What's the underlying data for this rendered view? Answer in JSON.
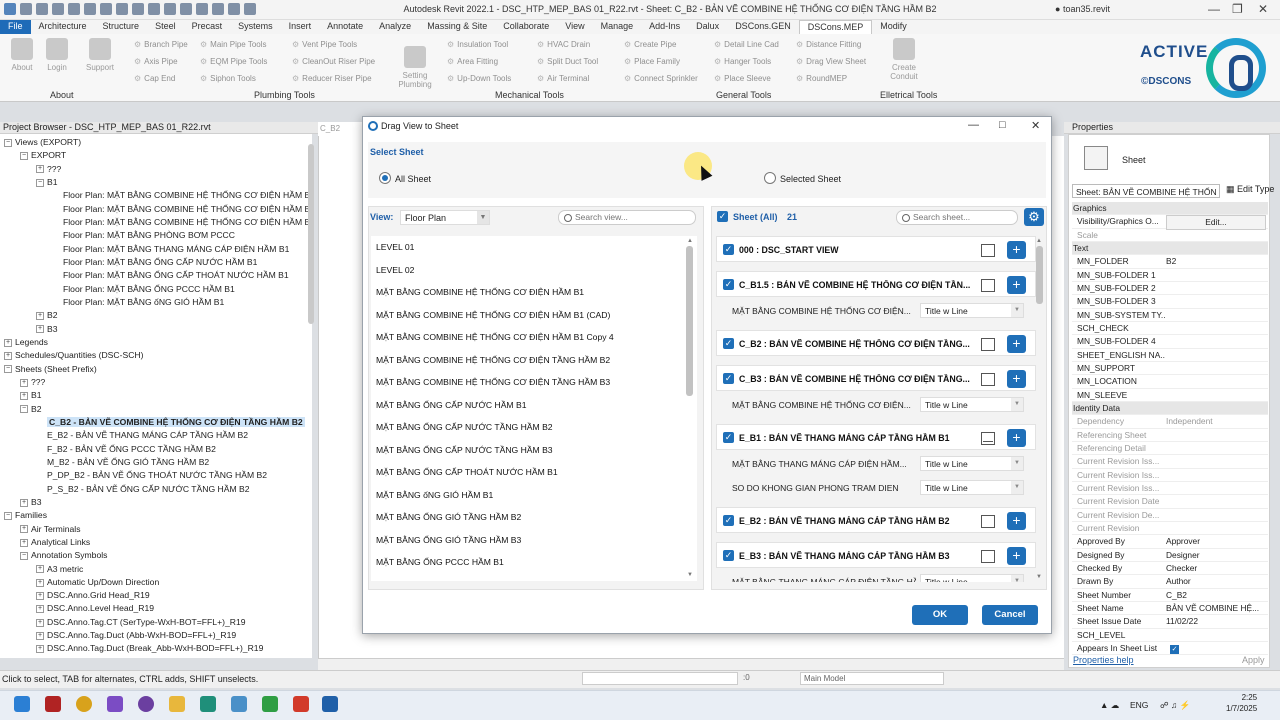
{
  "window": {
    "title": "Autodesk Revit 2022.1 - DSC_HTP_MEP_BAS 01_R22.rvt - Sheet: C_B2 - BẢN VẼ COMBINE HỆ THỐNG CƠ ĐIỆN TẦNG HẦM B2",
    "user": "toan35.revit"
  },
  "menu": [
    "File",
    "Architecture",
    "Structure",
    "Steel",
    "Precast",
    "Systems",
    "Insert",
    "Annotate",
    "Analyze",
    "Massing & Site",
    "Collaborate",
    "View",
    "Manage",
    "Add-Ins",
    "Dalux",
    "DSCons.GEN",
    "DSCons.MEP",
    "Modify"
  ],
  "ribbon": {
    "about": {
      "buttons": [
        "About",
        "Login",
        "Support"
      ],
      "label": "About"
    },
    "plumbing": {
      "col1": [
        "Branch Pipe",
        "Axis Pipe",
        "Cap End"
      ],
      "col2": [
        "Main Pipe Tools",
        "EQM Pipe Tools",
        "Siphon Tools"
      ],
      "col3": [
        "Vent Pipe Tools",
        "CleanOut Riser Pipe",
        "Reducer Riser Pipe"
      ],
      "big": "Setting Plumbing",
      "label": "Plumbing Tools"
    },
    "mechanical": {
      "col1": [
        "Insulation Tool",
        "Area Fitting",
        "Up-Down Tools"
      ],
      "col2": [
        "HVAC Drain",
        "Split Duct Tool",
        "Air Terminal"
      ],
      "label": "Mechanical Tools"
    },
    "general": {
      "col1": [
        "Create Pipe",
        "Place Family",
        "Connect Sprinkler"
      ],
      "col2": [
        "Detail Line Cad",
        "Hanger Tools",
        "Place Sleeve"
      ],
      "col3": [
        "Distance Fitting",
        "Drag View Sheet",
        "RoundMEP"
      ],
      "label": "General Tools"
    },
    "electrical": {
      "big": "Create Conduit",
      "label": "Elletrical Tools"
    }
  },
  "brand": {
    "active": "ACTIVE",
    "sub": "©DSCONS"
  },
  "project_browser": {
    "title": "Project Browser - DSC_HTP_MEP_BAS 01_R22.rvt",
    "rows": [
      {
        "i": 0,
        "e": "-",
        "t": "Views (EXPORT)"
      },
      {
        "i": 1,
        "e": "-",
        "t": "EXPORT"
      },
      {
        "i": 2,
        "e": "+",
        "t": "???"
      },
      {
        "i": 2,
        "e": "-",
        "t": "B1"
      },
      {
        "i": 3,
        "e": "",
        "t": "Floor Plan: MẶT BẰNG COMBINE HỆ THỐNG CƠ ĐIỆN HẦM B"
      },
      {
        "i": 3,
        "e": "",
        "t": "Floor Plan: MẶT BẰNG COMBINE HỆ THỐNG CƠ ĐIỆN HẦM B"
      },
      {
        "i": 3,
        "e": "",
        "t": "Floor Plan: MẶT BẰNG COMBINE HỆ THỐNG CƠ ĐIỆN HẦM B"
      },
      {
        "i": 3,
        "e": "",
        "t": "Floor Plan: MẶT BẰNG PHÒNG BƠM PCCC"
      },
      {
        "i": 3,
        "e": "",
        "t": "Floor Plan: MẶT BẰNG THANG MÁNG CÁP ĐIỆN HẦM B1"
      },
      {
        "i": 3,
        "e": "",
        "t": "Floor Plan: MẶT BẰNG ỐNG CẤP NƯỚC HẦM B1"
      },
      {
        "i": 3,
        "e": "",
        "t": "Floor Plan: MẶT BẰNG ỐNG CẤP THOÁT NƯỚC HẦM B1"
      },
      {
        "i": 3,
        "e": "",
        "t": "Floor Plan: MẶT BẰNG ỐNG PCCC HẦM B1"
      },
      {
        "i": 3,
        "e": "",
        "t": "Floor Plan: MẶT BẰNG ốNG GIÓ HẦM B1"
      },
      {
        "i": 2,
        "e": "+",
        "t": "B2"
      },
      {
        "i": 2,
        "e": "+",
        "t": "B3"
      },
      {
        "i": 0,
        "e": "+",
        "t": "Legends"
      },
      {
        "i": 0,
        "e": "+",
        "t": "Schedules/Quantities (DSC-SCH)"
      },
      {
        "i": 0,
        "e": "-",
        "t": "Sheets (Sheet Prefix)"
      },
      {
        "i": 1,
        "e": "+",
        "t": "???"
      },
      {
        "i": 1,
        "e": "+",
        "t": "B1"
      },
      {
        "i": 1,
        "e": "-",
        "t": "B2"
      },
      {
        "i": 2,
        "e": "",
        "t": "C_B2 - BẢN VẼ COMBINE HỆ THỐNG CƠ ĐIỆN TẦNG HẦM B2",
        "sel": true
      },
      {
        "i": 2,
        "e": "",
        "t": "E_B2 - BẢN VẼ THANG MÁNG CÁP TẦNG HẦM B2"
      },
      {
        "i": 2,
        "e": "",
        "t": "F_B2 - BẢN VẼ ỐNG PCCC TẦNG HẦM B2"
      },
      {
        "i": 2,
        "e": "",
        "t": "M_B2 - BẢN VẼ ỐNG GIÓ TẦNG HẦM B2"
      },
      {
        "i": 2,
        "e": "",
        "t": "P_DP_B2 - BẢN VẼ ỐNG THOÁT NƯỚC TẦNG HẦM B2"
      },
      {
        "i": 2,
        "e": "",
        "t": "P_S_B2 - BẢN VẼ ỐNG CẤP NƯỚC TẦNG HẦM B2"
      },
      {
        "i": 1,
        "e": "+",
        "t": "B3"
      },
      {
        "i": 0,
        "e": "-",
        "t": "Families"
      },
      {
        "i": 1,
        "e": "+",
        "t": "Air Terminals"
      },
      {
        "i": 1,
        "e": "+",
        "t": "Analytical Links"
      },
      {
        "i": 1,
        "e": "-",
        "t": "Annotation Symbols"
      },
      {
        "i": 2,
        "e": "+",
        "t": "A3 metric"
      },
      {
        "i": 2,
        "e": "+",
        "t": "Automatic Up/Down Direction"
      },
      {
        "i": 2,
        "e": "+",
        "t": "DSC.Anno.Grid Head_R19"
      },
      {
        "i": 2,
        "e": "+",
        "t": "DSC.Anno.Level Head_R19"
      },
      {
        "i": 2,
        "e": "+",
        "t": "DSC.Anno.Tag.CT (SerType-WxH-BOT=FFL+)_R19"
      },
      {
        "i": 2,
        "e": "+",
        "t": "DSC.Anno.Tag.Duct (Abb-WxH-BOD=FFL+)_R19"
      },
      {
        "i": 2,
        "e": "+",
        "t": "DSC.Anno.Tag.Duct (Break_Abb-WxH-BOD=FFL+)_R19"
      }
    ]
  },
  "canvas_tab": "C_B2",
  "dialog": {
    "title": "Drag View to Sheet",
    "select_sheet_label": "Select Sheet",
    "radio_all": "All Sheet",
    "radio_selected": "Selected Sheet",
    "view_label": "View:",
    "view_type": "Floor Plan",
    "search_view_placeholder": "Search view...",
    "views": [
      "LEVEL 01",
      "LEVEL 02",
      "MẶT BẰNG COMBINE HỆ THỐNG CƠ ĐIỆN HẦM B1",
      "MẶT BẰNG COMBINE HỆ THỐNG CƠ ĐIỆN HẦM B1 (CAD)",
      "MẶT BẰNG COMBINE HỆ THỐNG CƠ ĐIỆN HẦM B1 Copy 4",
      "MẶT BẰNG COMBINE HỆ THỐNG CƠ ĐIỆN TẦNG HẦM B2",
      "MẶT BẰNG COMBINE HỆ THỐNG CƠ ĐIỆN TẦNG HẦM B3",
      "MẶT BẰNG ỐNG CẤP NƯỚC HẦM B1",
      "MẶT BẰNG ỐNG CẤP NƯỚC TẦNG HẦM B2",
      "MẶT BẰNG ỐNG CẤP NƯỚC TẦNG HẦM B3",
      "MẶT BẰNG ỐNG CẤP THOÁT NƯỚC HẦM B1",
      "MẶT BẰNG ốNG GIÓ HẦM B1",
      "MẶT BẰNG ỐNG GIÓ TẦNG HẦM B2",
      "MẶT BẰNG ỐNG GIÓ TẦNG HẦM B3",
      "MẶT BẰNG ỐNG PCCC HẦM B1"
    ],
    "sheet_header": "Sheet (All)",
    "sheet_count": "21",
    "search_sheet_placeholder": "Search sheet...",
    "sheets": [
      {
        "t": "000 : DSC_START VIEW",
        "box": "empty",
        "subs": []
      },
      {
        "t": "C_B1.5 : BẢN VẼ COMBINE HỆ THỐNG CƠ ĐIỆN TẦN...",
        "box": "empty",
        "subs": [
          {
            "v": "MẶT BẰNG COMBINE HỆ THỐNG CƠ ĐIỆN...",
            "tb": "Title w Line"
          }
        ]
      },
      {
        "t": "C_B2 : BẢN VẼ COMBINE HỆ THỐNG CƠ ĐIỆN TẦNG...",
        "box": "empty",
        "subs": []
      },
      {
        "t": "C_B3 : BẢN VẼ COMBINE HỆ THỐNG CƠ ĐIỆN TẦNG...",
        "box": "empty",
        "subs": [
          {
            "v": "MẶT BẰNG COMBINE HỆ THỐNG CƠ ĐIỆN...",
            "tb": "Title w Line"
          }
        ]
      },
      {
        "t": "E_B1 : BẢN VẼ THANG MÁNG CÁP TẦNG HẦM B1",
        "box": "half",
        "subs": [
          {
            "v": "MẶT BẰNG THANG MÁNG CÁP ĐIỆN HẦM...",
            "tb": "Title w Line"
          },
          {
            "v": "SO DO KHONG GIAN PHONG TRAM DIEN",
            "tb": "Title w Line"
          }
        ]
      },
      {
        "t": "E_B2 : BẢN VẼ THANG MÁNG CÁP TẦNG HẦM B2",
        "box": "empty",
        "subs": []
      },
      {
        "t": "E_B3 : BẢN VẼ THANG MÁNG CÁP TẦNG HẦM B3",
        "box": "empty",
        "subs": [
          {
            "v": "MẶT BẰNG THANG MÁNG CÁP ĐIỆN TẦNG HẦ...",
            "tb": "Title w Line"
          }
        ]
      }
    ],
    "ok": "OK",
    "cancel": "Cancel"
  },
  "properties": {
    "title": "Properties",
    "type": "Sheet",
    "selector": "Sheet: BẢN VẼ COMBINE HỆ THỐN",
    "edit_type": "Edit Type",
    "rows": [
      {
        "g": "Graphics"
      },
      {
        "k": "Visibility/Graphics O...",
        "v": "Edit...",
        "btn": true
      },
      {
        "k": "Scale",
        "v": "",
        "dim": true
      },
      {
        "g": "Text"
      },
      {
        "k": "MN_FOLDER",
        "v": "B2"
      },
      {
        "k": "MN_SUB-FOLDER 1",
        "v": ""
      },
      {
        "k": "MN_SUB-FOLDER 2",
        "v": ""
      },
      {
        "k": "MN_SUB-FOLDER 3",
        "v": ""
      },
      {
        "k": "MN_SUB-SYSTEM TY...",
        "v": ""
      },
      {
        "k": "SCH_CHECK",
        "v": ""
      },
      {
        "k": "MN_SUB-FOLDER 4",
        "v": ""
      },
      {
        "k": "SHEET_ENGLISH NA...",
        "v": ""
      },
      {
        "k": "MN_SUPPORT",
        "v": ""
      },
      {
        "k": "MN_LOCATION",
        "v": ""
      },
      {
        "k": "MN_SLEEVE",
        "v": ""
      },
      {
        "g": "Identity Data"
      },
      {
        "k": "Dependency",
        "v": "Independent",
        "dim": true
      },
      {
        "k": "Referencing Sheet",
        "v": "",
        "dim": true
      },
      {
        "k": "Referencing Detail",
        "v": "",
        "dim": true
      },
      {
        "k": "Current Revision Iss...",
        "v": "",
        "dim": true
      },
      {
        "k": "Current Revision Iss...",
        "v": "",
        "dim": true
      },
      {
        "k": "Current Revision Iss...",
        "v": "",
        "dim": true
      },
      {
        "k": "Current Revision Date",
        "v": "",
        "dim": true
      },
      {
        "k": "Current Revision De...",
        "v": "",
        "dim": true
      },
      {
        "k": "Current Revision",
        "v": "",
        "dim": true
      },
      {
        "k": "Approved By",
        "v": "Approver"
      },
      {
        "k": "Designed By",
        "v": "Designer"
      },
      {
        "k": "Checked By",
        "v": "Checker"
      },
      {
        "k": "Drawn By",
        "v": "Author"
      },
      {
        "k": "Sheet Number",
        "v": "C_B2"
      },
      {
        "k": "Sheet Name",
        "v": "BẢN VẼ COMBINE HỆ..."
      },
      {
        "k": "Sheet Issue Date",
        "v": "11/02/22"
      },
      {
        "k": "SCH_LEVEL",
        "v": ""
      },
      {
        "k": "Appears In Sheet List",
        "v": "",
        "check": true
      }
    ],
    "help": "Properties help",
    "apply": "Apply"
  },
  "status": {
    "text": "Click to select, TAB for alternates, CTRL adds, SHIFT unselects.",
    "zero": ":0",
    "model": "Main Model"
  },
  "taskbar": {
    "lang": "ENG",
    "time": "2:25",
    "date": "1/7/2025"
  },
  "colors": {
    "accent": "#1f6fb8",
    "brand": "#1f4e8c",
    "selection": "#cde3f7"
  }
}
